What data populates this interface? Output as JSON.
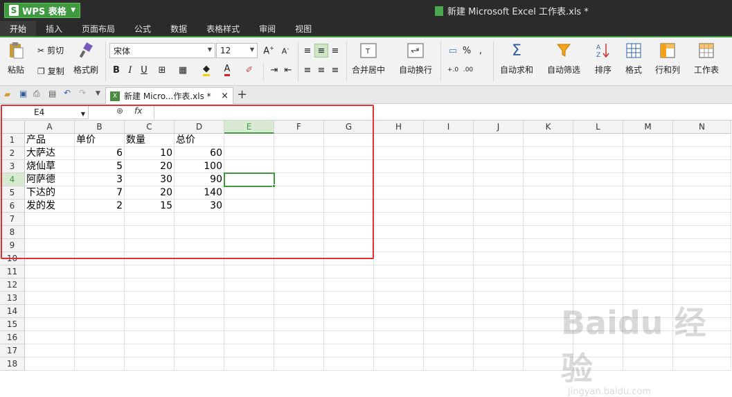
{
  "titlebar": {
    "app_label": "WPS 表格",
    "app_logo": "S",
    "document_title": "新建 Microsoft Excel 工作表.xls *"
  },
  "tabs": [
    "开始",
    "插入",
    "页面布局",
    "公式",
    "数据",
    "表格样式",
    "审阅",
    "视图"
  ],
  "toolbar": {
    "paste": "粘贴",
    "cut": "剪切",
    "copy": "复制",
    "format_painter": "格式刷",
    "font_name": "宋体",
    "font_size": "12",
    "bold": "B",
    "italic": "I",
    "underline": "U",
    "merge_center": "合并居中",
    "wrap_text": "自动换行",
    "percent": "%",
    "comma": ",",
    "autosum": "自动求和",
    "autofilter": "自动筛选",
    "sort": "排序",
    "format": "格式",
    "row_col": "行和列",
    "worksheet": "工作表"
  },
  "doc_tab": {
    "label": "新建 Micro...作表.xls *",
    "close": "×",
    "new_tab": "+"
  },
  "formula_bar": {
    "name_box": "E4",
    "fx": "fx",
    "formula": ""
  },
  "columns": [
    "A",
    "B",
    "C",
    "D",
    "E",
    "F",
    "G",
    "H",
    "I",
    "J",
    "K",
    "L",
    "M",
    "N"
  ],
  "rows": [
    "1",
    "2",
    "3",
    "4",
    "5",
    "6",
    "7",
    "8",
    "9",
    "10",
    "11",
    "12",
    "13",
    "14",
    "15",
    "16",
    "17",
    "18"
  ],
  "selected": {
    "column": "E",
    "row": "4"
  },
  "sheet": [
    [
      "产品",
      "单价",
      "数量",
      "总价"
    ],
    [
      "大萨达",
      "6",
      "10",
      "60"
    ],
    [
      "烧仙草",
      "5",
      "20",
      "100"
    ],
    [
      "阿萨德",
      "3",
      "30",
      "90"
    ],
    [
      "下达的",
      "7",
      "20",
      "140"
    ],
    [
      "发的发",
      "2",
      "15",
      "30"
    ]
  ],
  "watermark": {
    "logo": "Baidu 经验",
    "url": "jingyan.baidu.com"
  },
  "colors": {
    "accent": "#3f9a3f",
    "highlight": "#e03030",
    "titlebar": "#2b2b2b"
  }
}
